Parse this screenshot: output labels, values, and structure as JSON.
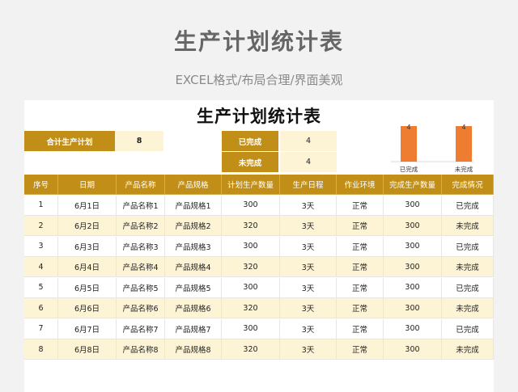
{
  "page": {
    "title": "生产计划统计表",
    "subtitle": "EXCEL格式/布局合理/界面美观"
  },
  "sheet": {
    "title": "生产计划统计表",
    "summary": {
      "plan_label": "合计生产计划",
      "plan_value": "8",
      "done_label": "已完成",
      "done_value": "4",
      "undone_label": "未完成",
      "undone_value": "4"
    },
    "colors": {
      "header": "#c18f17",
      "alt_row": "#fdf4d6",
      "bar": "#ef7d31"
    }
  },
  "chart_data": {
    "type": "bar",
    "categories": [
      "已完成",
      "未完成"
    ],
    "values": [
      4,
      4
    ],
    "data_labels": [
      "4",
      "4"
    ],
    "ylim": [
      0,
      4
    ],
    "grid": false,
    "legend": "none"
  },
  "table": {
    "columns": [
      "序号",
      "日期",
      "产品名称",
      "产品规格",
      "计划生产数量",
      "生产日程",
      "作业环境",
      "完成生产数量",
      "完成情况"
    ],
    "rows": [
      [
        "1",
        "6月1日",
        "产品名称1",
        "产品规格1",
        "300",
        "3天",
        "正常",
        "300",
        "已完成"
      ],
      [
        "2",
        "6月2日",
        "产品名称2",
        "产品规格2",
        "320",
        "3天",
        "正常",
        "300",
        "未完成"
      ],
      [
        "3",
        "6月3日",
        "产品名称3",
        "产品规格3",
        "300",
        "3天",
        "正常",
        "300",
        "已完成"
      ],
      [
        "4",
        "6月4日",
        "产品名称4",
        "产品规格4",
        "320",
        "3天",
        "正常",
        "300",
        "未完成"
      ],
      [
        "5",
        "6月5日",
        "产品名称5",
        "产品规格5",
        "300",
        "3天",
        "正常",
        "300",
        "已完成"
      ],
      [
        "6",
        "6月6日",
        "产品名称6",
        "产品规格6",
        "320",
        "3天",
        "正常",
        "300",
        "未完成"
      ],
      [
        "7",
        "6月7日",
        "产品名称7",
        "产品规格7",
        "300",
        "3天",
        "正常",
        "300",
        "已完成"
      ],
      [
        "8",
        "6月8日",
        "产品名称8",
        "产品规格8",
        "320",
        "3天",
        "正常",
        "300",
        "未完成"
      ]
    ]
  }
}
